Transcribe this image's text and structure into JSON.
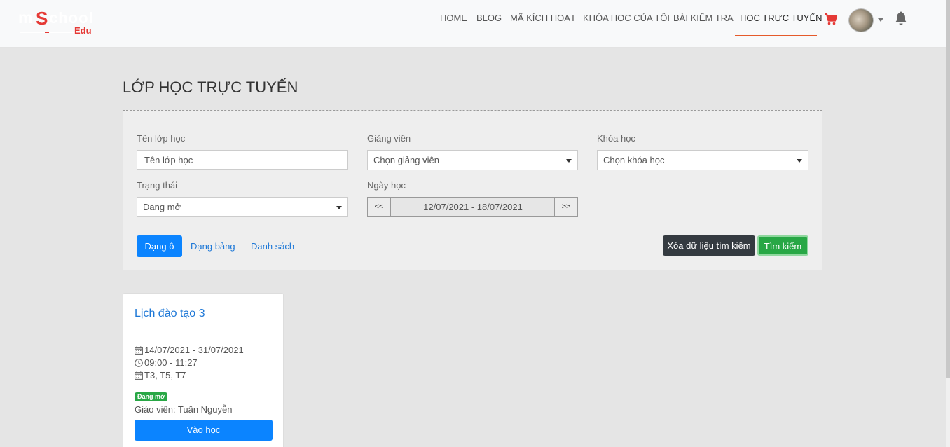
{
  "brand": {
    "logo_text": "mSchool Edu"
  },
  "nav": {
    "items": [
      {
        "label": "HOME"
      },
      {
        "label": "BLOG"
      },
      {
        "label": "MÃ KÍCH HOẠT"
      },
      {
        "label": "KHÓA HỌC CỦA TÔI"
      },
      {
        "label": "BÀI KIỂM TRA"
      },
      {
        "label": "HỌC TRỰC TUYẾN"
      }
    ],
    "active_index": 5,
    "icons": [
      "cart-icon",
      "avatar",
      "chevron-down-icon",
      "bell-icon"
    ]
  },
  "colors": {
    "accent_blue": "#0b84ff",
    "cart_red": "#e53935",
    "success_green": "#28a745",
    "dark_button": "#343a40",
    "nav_underline": "#e55a2b"
  },
  "page": {
    "title": "LỚP HỌC TRỰC TUYẾN"
  },
  "filters": {
    "class_name": {
      "label": "Tên lớp học",
      "placeholder": "Tên lớp học"
    },
    "teacher": {
      "label": "Giảng viên",
      "selected": "Chọn giảng viên"
    },
    "course": {
      "label": "Khóa học",
      "selected": "Chọn khóa học"
    },
    "status": {
      "label": "Trạng thái",
      "selected": "Đang mở"
    },
    "date": {
      "label": "Ngày học",
      "prev": "<<",
      "range": "12/07/2021 - 18/07/2021",
      "next": ">>"
    }
  },
  "views": {
    "grid": "Dạng ô",
    "table": "Dạng bảng",
    "list": "Danh sách"
  },
  "actions": {
    "clear": "Xóa dữ liệu tìm kiếm",
    "search": "Tìm kiếm"
  },
  "classes": [
    {
      "title": "Lịch đào tạo 3",
      "date_range": "14/07/2021 - 31/07/2021",
      "time": "09:00 - 11:27",
      "days": "T3, T5, T7",
      "status": "Đang mở",
      "teacher": "Giáo viên: Tuấn Nguyễn",
      "join_label": "Vào học"
    }
  ]
}
